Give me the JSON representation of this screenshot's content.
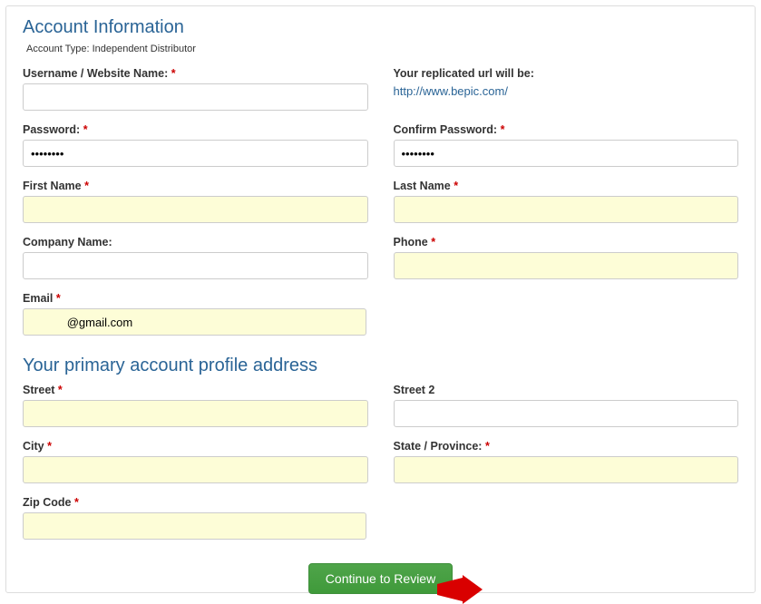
{
  "account": {
    "section_title": "Account Information",
    "type_label": "Account Type: Independent Distributor",
    "username_label": "Username / Website Name:",
    "username_value": "",
    "replicated_label": "Your replicated url will be:",
    "replicated_url": "http://www.bepic.com/",
    "password_label": "Password:",
    "password_value": "••••••••",
    "confirm_password_label": "Confirm Password:",
    "confirm_password_value": "••••••••",
    "first_name_label": "First Name",
    "first_name_value": "",
    "last_name_label": "Last Name",
    "last_name_value": "",
    "company_label": "Company Name:",
    "company_value": "",
    "phone_label": "Phone",
    "phone_value": "",
    "email_label": "Email",
    "email_value": "           @gmail.com"
  },
  "address": {
    "section_title": "Your primary account profile address",
    "street_label": "Street",
    "street_value": "",
    "street2_label": "Street 2",
    "street2_value": "",
    "city_label": "City",
    "city_value": "",
    "state_label": "State / Province:",
    "state_value": "",
    "zip_label": "Zip Code",
    "zip_value": ""
  },
  "button": {
    "continue_label": "Continue to Review"
  },
  "required_mark": "*",
  "colors": {
    "accent": "#2a6496",
    "button_bg": "#4fa44a",
    "highlight_bg": "#fdfdd7",
    "arrow": "#d90000"
  }
}
